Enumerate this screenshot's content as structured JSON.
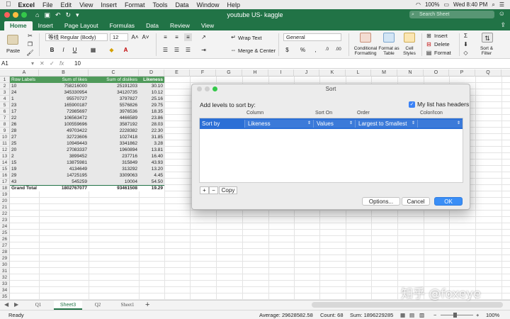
{
  "menubar": {
    "apple": "",
    "app": "Excel",
    "items": [
      "File",
      "Edit",
      "View",
      "Insert",
      "Format",
      "Tools",
      "Data",
      "Window",
      "Help"
    ],
    "battery": "100%",
    "clock": "Wed 8:40 PM"
  },
  "window": {
    "title": "youtube US- kaggle",
    "search_placeholder": "Search Sheet"
  },
  "tabs": [
    "Home",
    "Insert",
    "Page Layout",
    "Formulas",
    "Data",
    "Review",
    "View"
  ],
  "ribbon": {
    "paste": "Paste",
    "font_name": "等线 Regular (Body)",
    "font_size": "12",
    "wrap_text": "Wrap Text",
    "merge_center": "Merge & Center",
    "number_format": "General",
    "conditional_formatting": "Conditional Formatting",
    "format_as_table": "Format as Table",
    "cell_styles": "Cell Styles",
    "insert": "Insert",
    "delete": "Delete",
    "format": "Format",
    "sort_filter": "Sort & Filter",
    "bold": "B",
    "italic": "I",
    "underline": "U"
  },
  "formula_bar": {
    "name_box": "A1",
    "fx": "fx",
    "value": "10"
  },
  "columns": [
    "A",
    "B",
    "C",
    "D",
    "E",
    "F",
    "G",
    "H",
    "I",
    "J",
    "K",
    "L",
    "M",
    "N",
    "O",
    "P",
    "Q"
  ],
  "pivot": {
    "headers": [
      "Row Labels",
      "Sum of likes",
      "Sum of dislikes",
      "Likeness"
    ],
    "rows": [
      [
        "10",
        "758216000",
        "25191203",
        "30.10"
      ],
      [
        "24",
        "345330954",
        "34120735",
        "10.12"
      ],
      [
        "1",
        "95570727",
        "3797827",
        "25.16"
      ],
      [
        "23",
        "165900187",
        "5576826",
        "29.75"
      ],
      [
        "17",
        "72985697",
        "3976536",
        "18.35"
      ],
      [
        "22",
        "106563472",
        "4466589",
        "23.86"
      ],
      [
        "26",
        "100559696",
        "3587192",
        "28.03"
      ],
      [
        "28",
        "49703422",
        "2228382",
        "22.30"
      ],
      [
        "27",
        "32723606",
        "1027418",
        "31.85"
      ],
      [
        "25",
        "10949443",
        "3341862",
        "3.28"
      ],
      [
        "20",
        "27083337",
        "1960894",
        "13.81"
      ],
      [
        "2",
        "3899452",
        "237716",
        "16.40"
      ],
      [
        "15",
        "13875981",
        "315849",
        "43.93"
      ],
      [
        "19",
        "4134649",
        "313292",
        "13.20"
      ],
      [
        "29",
        "14725195",
        "3309063",
        "4.45"
      ],
      [
        "43",
        "545259",
        "10004",
        "54.50"
      ]
    ],
    "total": [
      "Grand Total",
      "1802767077",
      "93461508",
      "19.29"
    ]
  },
  "sheet_tabs": [
    "Q1",
    "Sheet3",
    "Q2",
    "Sheet1"
  ],
  "status": {
    "ready": "Ready",
    "average": "Average: 29628582.58",
    "count": "Count: 68",
    "sum": "Sum: 1896229285",
    "zoom": "100%"
  },
  "dialog": {
    "title": "Sort",
    "instruction": "Add levels to sort by:",
    "my_list_has_headers": "My list has headers",
    "headers_checked": true,
    "col_headers": [
      "Column",
      "Sort On",
      "Order",
      "Color/Icon"
    ],
    "row": {
      "label": "Sort by",
      "column": "Likeness",
      "sort_on": "Values",
      "order": "Largest to Smallest",
      "color_icon": ""
    },
    "add": "+",
    "remove": "−",
    "copy": "Copy",
    "options": "Options...",
    "cancel": "Cancel",
    "ok": "OK"
  },
  "watermark": "知乎 @foxeye",
  "colors": {
    "excel_green": "#217346",
    "selection_blue": "#2b6fd6",
    "ok_blue": "#3a8ef6"
  }
}
